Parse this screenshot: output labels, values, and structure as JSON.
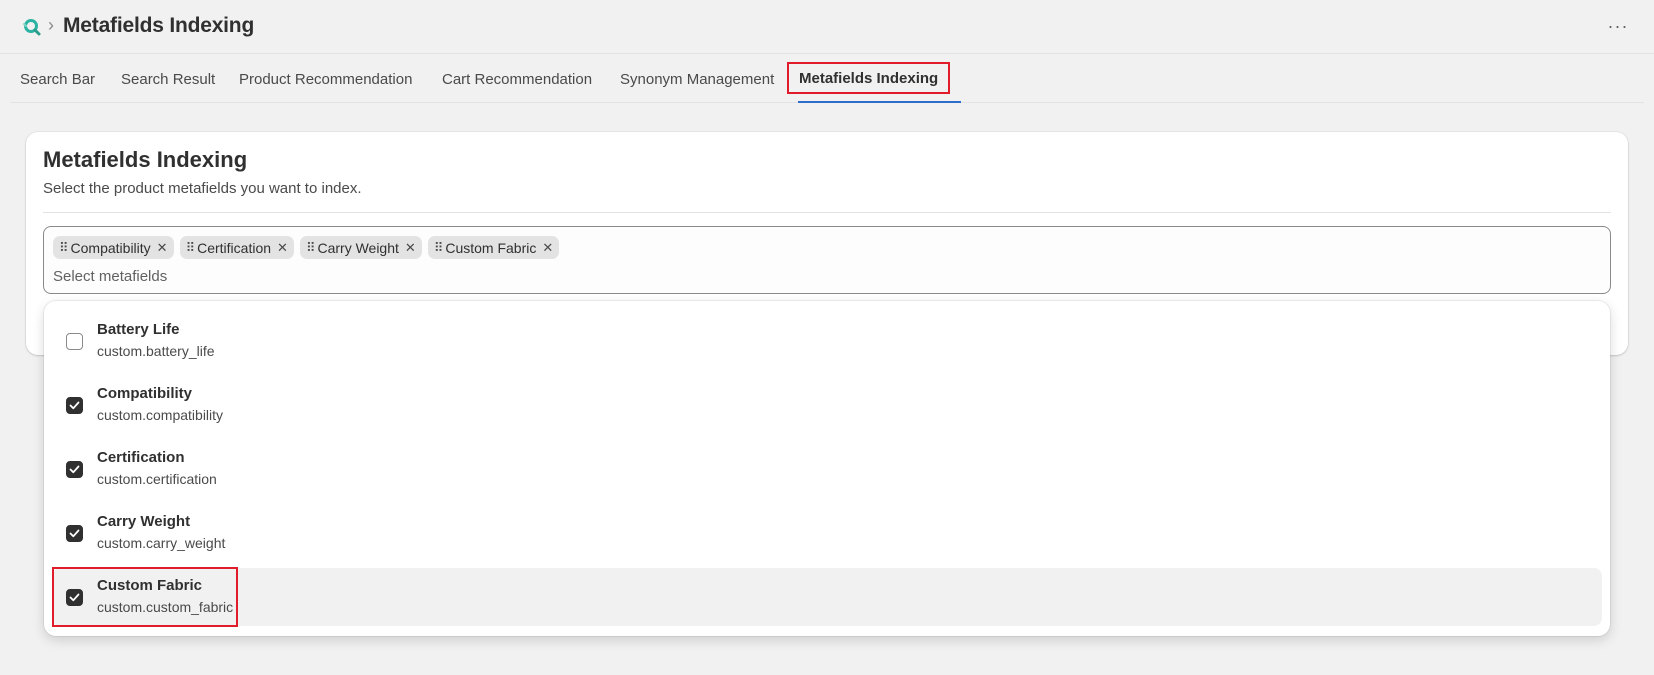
{
  "header": {
    "app_icon": "search-logo-icon",
    "breadcrumb_separator": "›",
    "title": "Metafields Indexing",
    "more_icon": "ellipsis-icon",
    "more_label": "···"
  },
  "tabs": [
    {
      "label": "Search Bar",
      "active": false
    },
    {
      "label": "Search Result",
      "active": false
    },
    {
      "label": "Product Recommendation",
      "active": false
    },
    {
      "label": "Cart Recommendation",
      "active": false
    },
    {
      "label": "Synonym Management",
      "active": false
    },
    {
      "label": "Metafields Indexing",
      "active": true
    }
  ],
  "card": {
    "title": "Metafields Indexing",
    "subtitle": "Select the product metafields you want to index."
  },
  "combobox": {
    "tags": [
      {
        "label": "Compatibility"
      },
      {
        "label": "Certification"
      },
      {
        "label": "Carry Weight"
      },
      {
        "label": "Custom Fabric"
      }
    ],
    "grip_glyph": "⠿",
    "remove_glyph": "✕",
    "placeholder": "Select metafields",
    "value": ""
  },
  "dropdown": {
    "options": [
      {
        "label": "Battery Life",
        "key": "custom.battery_life",
        "checked": false
      },
      {
        "label": "Compatibility",
        "key": "custom.compatibility",
        "checked": true
      },
      {
        "label": "Certification",
        "key": "custom.certification",
        "checked": true
      },
      {
        "label": "Carry Weight",
        "key": "custom.carry_weight",
        "checked": true
      },
      {
        "label": "Custom Fabric",
        "key": "custom.custom_fabric",
        "checked": true
      }
    ]
  },
  "colors": {
    "accent_highlight": "#e01c2b",
    "tab_underline": "#2c6ecb",
    "checkbox_checked": "#303030"
  }
}
